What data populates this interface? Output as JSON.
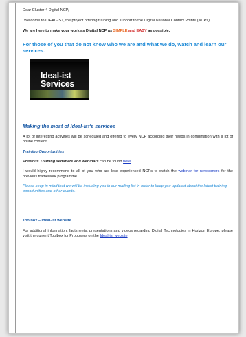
{
  "greeting": "Dear Cluster 4 Digital NCP,",
  "welcome": "Welcome to IDEAL-IST, the project offering training and support to the Digital National Contact Points (NCPs).",
  "simple_line": {
    "prefix": "We are here to make your work as Digital NCP as ",
    "simple": "SIMPLE",
    "and": " and ",
    "easy": "EASY",
    "suffix": " as possible."
  },
  "intro_heading": "For those of you that do not know who we are and what we do, watch and learn our services.",
  "video": {
    "line1": "Ideal-ist",
    "line2": "Services"
  },
  "services_heading": "Making the most of Ideal-ist's services",
  "services_text": "A lot of interesting activities will be scheduled and offered to every NCP according their needs in combination with a lot of online content.",
  "training_heading": "Training Opportunities",
  "previous_training": {
    "bold": "Previous Training seminars and webinars",
    "middle": " can be found ",
    "link": "here",
    "end": "."
  },
  "recommend": {
    "prefix": "I would highly recommend to all of you who are less experienced NCPs to watch the ",
    "link": "webinar for newcomers",
    "suffix": " for the previous framework programme."
  },
  "mailing_notice": "Please keep in mind that we will be including you in our mailing list in order to keep you updated about the latest training opportunities and other events.",
  "toolbox_heading": "Toolbox – Ideal-ist website",
  "toolbox_text": {
    "prefix": "For additional information, factsheets, presentations and videos regarding Digital Technologies in Horizon Europe, please visit the current Toolbox for Proposers on the ",
    "link": "Ideal-ist website"
  },
  "colors": {
    "accent_blue": "#1e8ad6",
    "heading_blue": "#1f5ea8",
    "link_blue": "#1a3cc4",
    "orange": "#e8641c",
    "red": "#d12929"
  }
}
